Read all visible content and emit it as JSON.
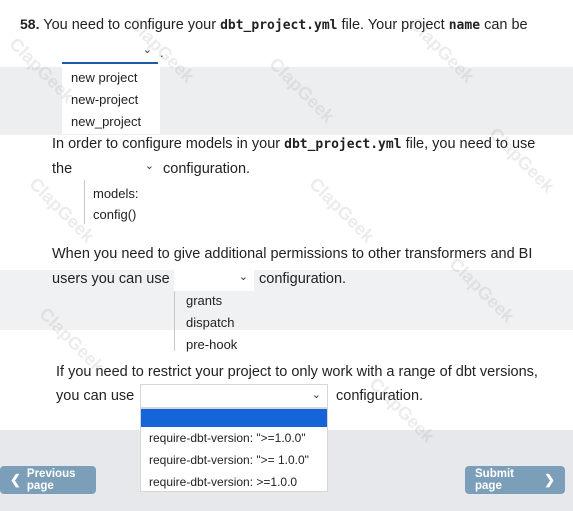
{
  "question": {
    "number": "58.",
    "line1_a": "You need to configure your",
    "line1_code": "dbt_project.yml",
    "line1_b": "file. Your project",
    "line1_code2": "name",
    "line1_c": "can be",
    "dot": "."
  },
  "dropdown1": {
    "options": [
      "new project",
      "new-project",
      "new_project"
    ]
  },
  "part2": {
    "a": "In order to configure models in your",
    "code": "dbt_project.yml",
    "b": "file, you need to use",
    "c": "the",
    "d": "configuration.",
    "options": [
      "models:",
      "config()"
    ]
  },
  "part3": {
    "a": "When you need to give additional permissions to other transformers and BI",
    "b": "users you can use",
    "c": "configuration.",
    "options": [
      "grants",
      "dispatch",
      "pre-hook"
    ]
  },
  "part4": {
    "a": "If you need to restrict your project to only work with a range of dbt versions,",
    "b": "you can use",
    "c": "configuration.",
    "options": [
      "require-dbt-version: \">=1.0.0\"",
      "require-dbt-version: \">= 1.0.0\"",
      "require-dbt-version: >=1.0.0"
    ]
  },
  "nav": {
    "previous": "Previous page",
    "submit": "Submit page"
  },
  "watermark": "ClapGeek",
  "colors": {
    "accent": "#1f5aa8",
    "selected": "#1565d8",
    "button": "#7c9fb9"
  }
}
